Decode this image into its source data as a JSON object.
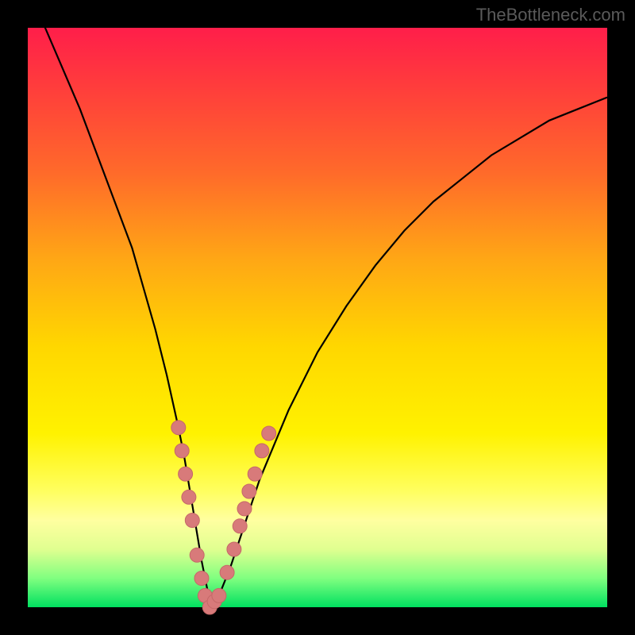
{
  "watermark": "TheBottleneck.com",
  "chart_data": {
    "type": "line",
    "title": "",
    "xlabel": "",
    "ylabel": "",
    "xlim": [
      0,
      100
    ],
    "ylim": [
      0,
      100
    ],
    "series": [
      {
        "name": "bottleneck-curve",
        "x": [
          0,
          3,
          6,
          9,
          12,
          15,
          18,
          20,
          22,
          24,
          26,
          27,
          28,
          29,
          30,
          31,
          32,
          33,
          35,
          37,
          40,
          45,
          50,
          55,
          60,
          65,
          70,
          75,
          80,
          85,
          90,
          95,
          100
        ],
        "y": [
          105,
          100,
          93,
          86,
          78,
          70,
          62,
          55,
          48,
          40,
          31,
          26,
          20,
          14,
          8,
          3,
          0,
          2,
          7,
          13,
          22,
          34,
          44,
          52,
          59,
          65,
          70,
          74,
          78,
          81,
          84,
          86,
          88
        ]
      }
    ],
    "scatter": {
      "name": "highlight-dots",
      "points": [
        {
          "x": 26.0,
          "y": 31
        },
        {
          "x": 26.6,
          "y": 27
        },
        {
          "x": 27.2,
          "y": 23
        },
        {
          "x": 27.8,
          "y": 19
        },
        {
          "x": 28.4,
          "y": 15
        },
        {
          "x": 29.2,
          "y": 9
        },
        {
          "x": 30.0,
          "y": 5
        },
        {
          "x": 30.6,
          "y": 2
        },
        {
          "x": 31.4,
          "y": 0
        },
        {
          "x": 32.2,
          "y": 1
        },
        {
          "x": 33.0,
          "y": 2
        },
        {
          "x": 34.4,
          "y": 6
        },
        {
          "x": 35.6,
          "y": 10
        },
        {
          "x": 36.6,
          "y": 14
        },
        {
          "x": 37.4,
          "y": 17
        },
        {
          "x": 38.2,
          "y": 20
        },
        {
          "x": 39.2,
          "y": 23
        },
        {
          "x": 40.4,
          "y": 27
        },
        {
          "x": 41.6,
          "y": 30
        }
      ]
    },
    "gradient_stops": [
      {
        "pos": 0,
        "color": "#ff1e4a"
      },
      {
        "pos": 25,
        "color": "#ff6a2a"
      },
      {
        "pos": 55,
        "color": "#ffd700"
      },
      {
        "pos": 80,
        "color": "#ffff60"
      },
      {
        "pos": 100,
        "color": "#00e060"
      }
    ]
  }
}
